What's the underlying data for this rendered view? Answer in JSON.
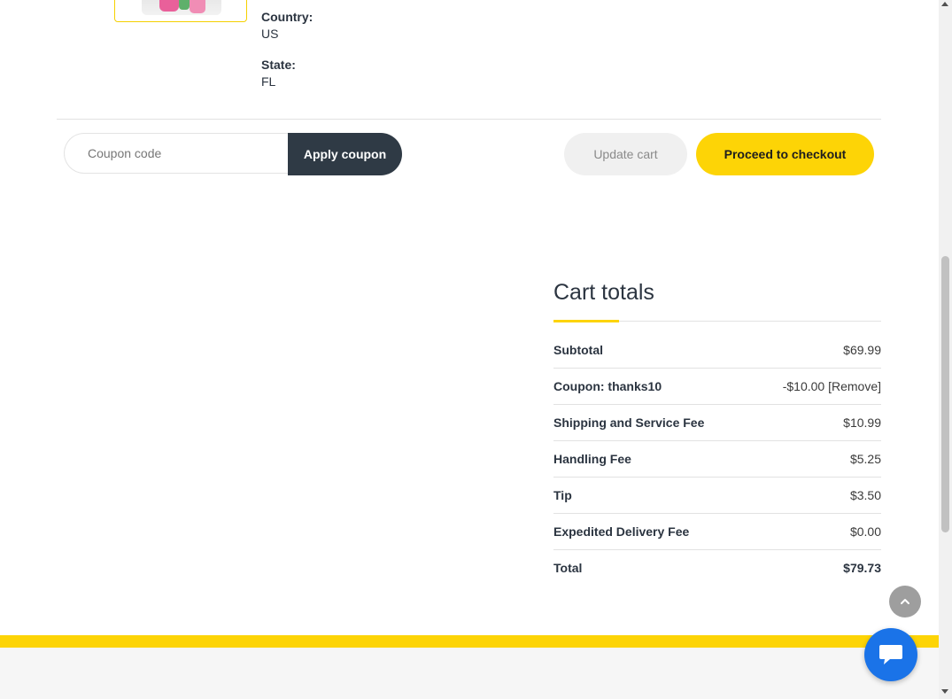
{
  "item_meta": {
    "country_label": "Country:",
    "country_value": "US",
    "state_label": "State:",
    "state_value": "FL"
  },
  "coupon": {
    "placeholder": "Coupon code",
    "apply_label": "Apply coupon"
  },
  "actions": {
    "update_label": "Update cart",
    "checkout_label": "Proceed to checkout"
  },
  "cart_totals": {
    "title": "Cart totals",
    "subtotal_label": "Subtotal",
    "subtotal_value": "$69.99",
    "coupon_label": "Coupon: thanks10",
    "coupon_value": "-$10.00",
    "coupon_remove": "[Remove]",
    "shipping_label": "Shipping and Service Fee",
    "shipping_value": "$10.99",
    "handling_label": "Handling Fee",
    "handling_value": "$5.25",
    "tip_label": "Tip",
    "tip_value": "$3.50",
    "expedited_label": "Expedited Delivery Fee",
    "expedited_value": "$0.00",
    "total_label": "Total",
    "total_value": "$79.73"
  },
  "colors": {
    "accent": "#fdd406",
    "dark_button": "#2f3a45",
    "chat_button": "#1a73e8"
  },
  "icons": {
    "scroll_top": "chevron-up-icon",
    "chat": "chat-bubble-icon"
  }
}
